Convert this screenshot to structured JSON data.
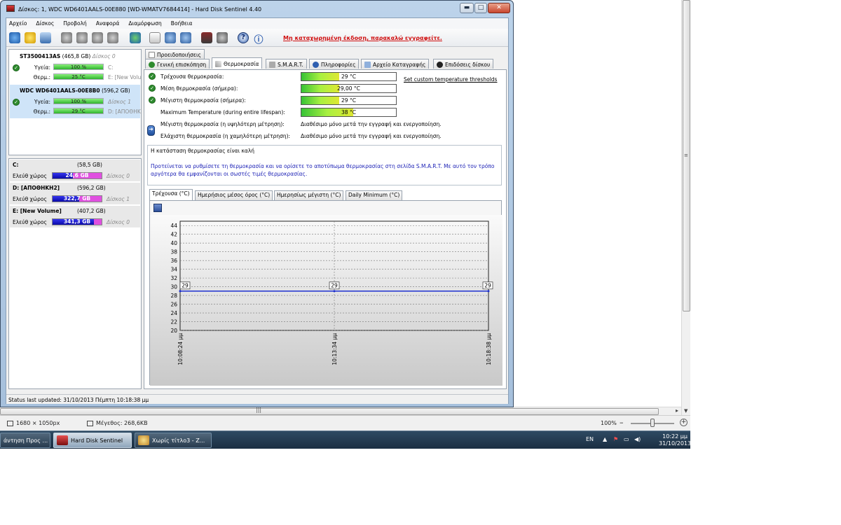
{
  "window": {
    "title": "Δίσκος: 1, WDC WD6401AALS-00E880 [WD-WMATV7684414]  -  Hard Disk Sentinel 4.40",
    "controls": {
      "minimize": "▬",
      "maximize": "□",
      "close": "✕"
    }
  },
  "menu": [
    "Αρχείο",
    "Δίσκος",
    "Προβολή",
    "Αναφορά",
    "Διαμόρφωση",
    "Βοήθεια"
  ],
  "toolbar": {
    "register_link": "Μη καταχωρημένη έκδοση, παρακαλώ εγγραφείτε."
  },
  "disks": [
    {
      "model": "ST3500413AS",
      "size": "(465,8 GB)",
      "disk_no": "Δίσκος 0",
      "health_label": "Υγεία:",
      "health": "100 %",
      "health_extra": "C:",
      "temp_label": "Θερμ.:",
      "temp": "25 °C",
      "temp_extra": "E: [New Volum"
    },
    {
      "model": "WDC WD6401AALS-00E8B0",
      "size": "(596,2 GB)",
      "disk_no": "",
      "health_label": "Υγεία:",
      "health": "100 %",
      "health_extra": "Δίσκος 1",
      "temp_label": "Θερμ.:",
      "temp": "29 °C",
      "temp_extra": "D: [ΑΠΟΘΗΚ"
    }
  ],
  "volumes": [
    {
      "name": "C:",
      "size": "(58,5 GB)",
      "free_label": "Ελεύθ χώρος",
      "free": "24,6 GB",
      "free_ratio": 0.42,
      "disk": "Δίσκος 0"
    },
    {
      "name": "D: [ΑΠΟΘΗΚΗ2]",
      "size": "(596,2 GB)",
      "free_label": "Ελεύθ χώρος",
      "free": "322,7 GB",
      "free_ratio": 0.54,
      "disk": "Δίσκος 1"
    },
    {
      "name": "E: [New Volume]",
      "size": "(407,2 GB)",
      "free_label": "Ελεύθ χώρος",
      "free": "341,3 GB",
      "free_ratio": 0.84,
      "disk": "Δίσκος 0"
    }
  ],
  "tabs": {
    "row1": [
      "Προειδοποιήσεις"
    ],
    "row2": [
      "Γενική επισκόπηση",
      "Θερμοκρασία",
      "S.M.A.R.T.",
      "Πληροφορίες",
      "Αρχείο Καταγραφής",
      "Επιδόσεις δίσκου"
    ],
    "active": "Θερμοκρασία"
  },
  "temperature": {
    "rows": [
      {
        "label": "Τρέχουσα θερμοκρασία:",
        "value": "29 °C",
        "fill": 0.4
      },
      {
        "label": "Μέση θερμοκρασία (σήμερα):",
        "value": "29,00 °C",
        "fill": 0.4
      },
      {
        "label": "Μέγιστη θερμοκρασία (σήμερα):",
        "value": "29 °C",
        "fill": 0.4
      },
      {
        "label": "Maximum Temperature (during entire lifespan):",
        "value": "38 °C",
        "fill": 0.55
      },
      {
        "label": "Μέγιστη θερμοκρασία (η υψηλότερη μέτρηση):",
        "note": "Διαθέσιμο μόνο μετά την εγγραφή και ενεργοποίηση."
      },
      {
        "label": "Ελάχιστη θερμοκρασία (η χαμηλότερη μέτρηση):",
        "note": "Διαθέσιμο μόνο μετά την εγγραφή και ενεργοποίηση."
      }
    ],
    "thresholds_link": "Set custom temperature thresholds",
    "status": "Η κατάσταση θερμοκρασίας είναι καλή",
    "advice": "Προτείνεται να ρυθμίσετε τη θερμοκρασία και να ορίσετε το αποτύπωμα θερμοκρασίας στη σελίδα S.M.A.R.T. Με αυτό τον τρόπο αργότερα θα εμφανίζονται οι σωστές τιμές θερμοκρασίας."
  },
  "chart_tabs": [
    "Τρέχουσα (°C)",
    "Ημερήσιος μέσος όρος (°C)",
    "Ημερησίως μέγιστη (°C)",
    "Daily Minimum (°C)"
  ],
  "chart_data": {
    "type": "line",
    "x": [
      "10:08:24 μμ",
      "10:13:34 μμ",
      "10:18:38 μμ"
    ],
    "y": [
      29,
      29,
      29
    ],
    "point_labels": [
      "29",
      "29",
      "29"
    ],
    "ylim": [
      20,
      45
    ],
    "yticks": [
      20,
      22,
      24,
      26,
      28,
      30,
      32,
      34,
      36,
      38,
      40,
      42,
      44
    ],
    "grid": true,
    "series_color": "#1c2fd0"
  },
  "statusbar": "Status last updated: 31/10/2013 Πέμπτη 10:18:38 μμ",
  "paint_status": {
    "dimensions": "1680 × 1050px",
    "size": "Μέγεθος: 268,6KB",
    "zoom": "100%"
  },
  "taskbar": {
    "items": [
      "άντηση Προς ...",
      "Hard Disk Sentinel",
      "Χωρίς τίτλο3 - Ζ..."
    ],
    "lang": "EN",
    "time": "10:22 μμ",
    "date": "31/10/2013"
  }
}
